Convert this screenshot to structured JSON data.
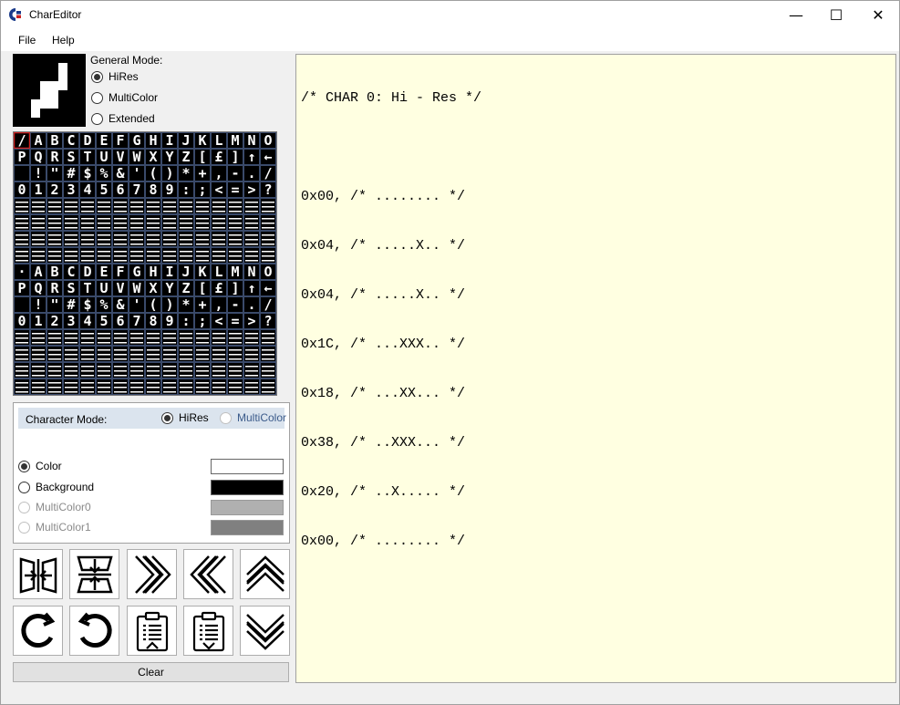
{
  "window": {
    "title": "CharEditor",
    "minimize_glyph": "—",
    "maximize_glyph": "☐",
    "close_glyph": "✕"
  },
  "menu": {
    "items": [
      "File",
      "Help"
    ]
  },
  "general_mode": {
    "label": "General Mode:",
    "options": [
      "HiRes",
      "MultiColor",
      "Extended"
    ],
    "selected": "HiRes"
  },
  "preview": {
    "character_index": 0,
    "rows": [
      "........",
      ".....X..",
      ".....X..",
      "...XXX..",
      "...XX...",
      "..XXX...",
      "..X.....",
      "........"
    ]
  },
  "character_mode": {
    "label": "Character Mode:",
    "options": [
      "HiRes",
      "MultiColor"
    ],
    "selected": "HiRes",
    "colors": [
      {
        "label": "Color",
        "value": "#ffffff",
        "enabled": true,
        "checked": true
      },
      {
        "label": "Background",
        "value": "#000000",
        "enabled": true,
        "checked": false
      },
      {
        "label": "MultiColor0",
        "value": "#b0b0b0",
        "enabled": false,
        "checked": false
      },
      {
        "label": "MultiColor1",
        "value": "#808080",
        "enabled": false,
        "checked": false
      }
    ]
  },
  "tools": [
    {
      "name": "flip-horizontal",
      "icon": "flip-horizontal-icon"
    },
    {
      "name": "flip-vertical",
      "icon": "flip-vertical-icon"
    },
    {
      "name": "shift-right",
      "icon": "double-chevron-right-icon"
    },
    {
      "name": "shift-left",
      "icon": "double-chevron-left-icon"
    },
    {
      "name": "shift-up",
      "icon": "double-chevron-up-icon"
    },
    {
      "name": "rotate-clockwise",
      "icon": "rotate-cw-icon"
    },
    {
      "name": "rotate-counterclockwise",
      "icon": "rotate-ccw-icon"
    },
    {
      "name": "copy",
      "icon": "clipboard-copy-icon"
    },
    {
      "name": "paste",
      "icon": "clipboard-paste-icon"
    },
    {
      "name": "shift-down",
      "icon": "double-chevron-down-icon"
    }
  ],
  "clear_label": "Clear",
  "code": {
    "lines": [
      "/* CHAR 0: Hi - Res */",
      "",
      "0x00, /* ........ */",
      "0x04, /* .....X.. */",
      "0x04, /* .....X.. */",
      "0x1C, /* ...XXX.. */",
      "0x18, /* ...XX... */",
      "0x38, /* ..XXX... */",
      "0x20, /* ..X..... */",
      "0x00, /* ........ */"
    ]
  },
  "charset": {
    "rows": [
      "/ABCDEFGHIJKLMNO",
      "PQRSTUVWXYZ[£]↑←",
      " !\"#$%&'()*+,-./",
      "0123456789:;<=>?",
      "",
      "",
      "",
      "",
      "·ABCDEFGHIJKLMNO",
      "PQRSTUVWXYZ[£]↑←",
      " !\"#$%&'()*+,-./",
      "0123456789:;<=>?",
      "",
      "",
      "",
      ""
    ],
    "accent": "#cc2222"
  }
}
